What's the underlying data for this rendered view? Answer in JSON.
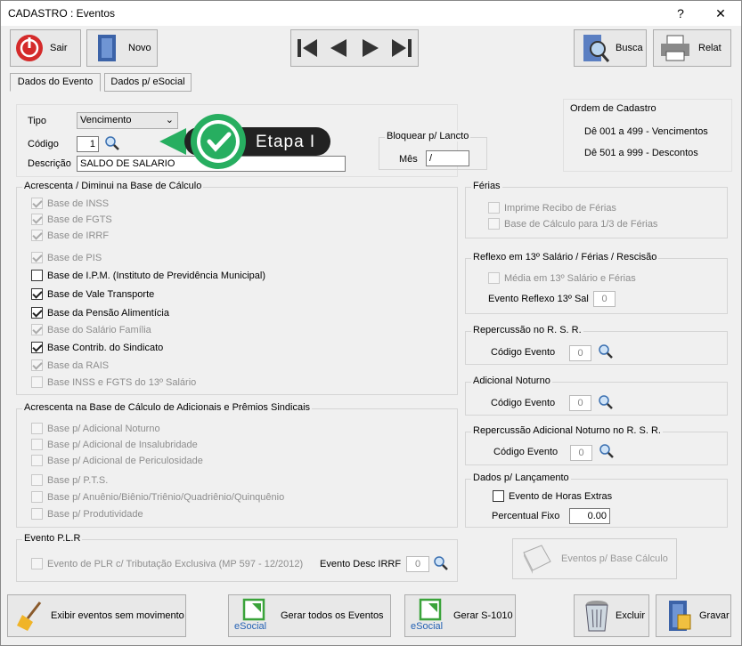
{
  "window": {
    "title": "CADASTRO : Eventos",
    "help": "?",
    "close": "✕"
  },
  "toolbar": {
    "sair": "Sair",
    "novo": "Novo",
    "busca": "Busca",
    "relat": "Relat"
  },
  "tabs": [
    "Dados do Evento",
    "Dados p/ eSocial"
  ],
  "form": {
    "tipo_label": "Tipo",
    "tipo_value": "Vencimento",
    "codigo_label": "Código",
    "codigo_value": "1",
    "descricao_label": "Descrição",
    "descricao_value": "SALDO DE SALARIO"
  },
  "callout": {
    "text": "Etapa I"
  },
  "bloquear": {
    "title": "Bloquear p/ Lancto",
    "mes_label": "Mês",
    "mes_value": " /"
  },
  "ordem": {
    "title": "Ordem de Cadastro",
    "line1": "Dê 001 a 499 - Vencimentos",
    "line2": "Dê 501 a 999 - Descontos"
  },
  "base_calculo": {
    "title": "Acrescenta / Diminui na Base de Cálculo",
    "items": [
      {
        "label": "Base de INSS"
      },
      {
        "label": "Base de FGTS"
      },
      {
        "label": "Base de IRRF"
      },
      {
        "label": "Base de PIS"
      },
      {
        "label": "Base de I.P.M. (Instituto de Previdência Municipal)"
      },
      {
        "label": "Base de Vale Transporte"
      },
      {
        "label": "Base da Pensão Alimentícia"
      },
      {
        "label": "Base do Salário Família"
      },
      {
        "label": "Base Contrib. do Sindicato"
      },
      {
        "label": "Base da RAIS"
      },
      {
        "label": "Base INSS e FGTS do 13º Salário"
      }
    ]
  },
  "adicionais": {
    "title": "Acrescenta na Base de Cálculo de Adicionais e Prêmios Sindicais",
    "items": [
      {
        "label": "Base p/ Adicional Noturno"
      },
      {
        "label": "Base p/ Adicional de Insalubridade"
      },
      {
        "label": "Base p/ Adicional de Periculosidade"
      },
      {
        "label": "Base p/ P.T.S."
      },
      {
        "label": "Base p/ Anuênio/Biênio/Triênio/Quadriênio/Quinquênio"
      },
      {
        "label": "Base p/ Produtividade"
      }
    ]
  },
  "plr": {
    "title": "Evento P.L.R",
    "check": "Evento de PLR c/ Tributação Exclusiva (MP 597 - 12/2012)",
    "desc_label": "Evento Desc IRRF",
    "desc_value": "0"
  },
  "ferias": {
    "title": "Férias",
    "item1": "Imprime Recibo de Férias",
    "item2": "Base de Cálculo para 1/3 de Férias"
  },
  "reflexo": {
    "title": "Reflexo em 13º Salário / Férias / Rescisão",
    "item1": "Média em 13º Salário e Férias",
    "evento_label": "Evento Reflexo 13º Sal",
    "evento_value": "0"
  },
  "rsr": {
    "title": "Repercussão no R. S. R.",
    "label": "Código Evento",
    "value": "0"
  },
  "noturno": {
    "title": "Adicional Noturno",
    "label": "Código Evento",
    "value": "0"
  },
  "rsr_noturno": {
    "title": "Repercussão Adicional Noturno no R. S. R.",
    "label": "Código Evento",
    "value": "0"
  },
  "lancamento": {
    "title": "Dados p/ Lançamento",
    "check": "Evento de Horas Extras",
    "perc_label": "Percentual Fixo",
    "perc_value": "0.00"
  },
  "eventos_base": {
    "label": "Eventos p/ Base Cálculo"
  },
  "bottom": {
    "exibir": "Exibir eventos sem movimento",
    "gerar_todos": "Gerar todos os Eventos",
    "gerar_s1010": "Gerar S-1010",
    "excluir": "Excluir",
    "gravar": "Gravar",
    "esocial": "eSocial"
  },
  "colors": {
    "accent_green": "#27ae60",
    "callout_dark": "#222222"
  }
}
